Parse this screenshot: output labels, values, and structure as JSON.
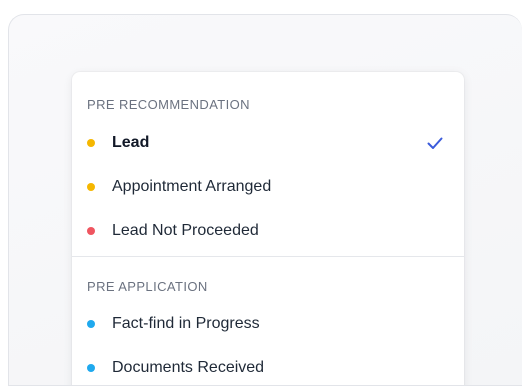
{
  "dropdown": {
    "sections": [
      {
        "header": "PRE RECOMMENDATION",
        "options": [
          {
            "label": "Lead",
            "dot_color": "#f5b700",
            "selected": true
          },
          {
            "label": "Appointment Arranged",
            "dot_color": "#f5b700",
            "selected": false
          },
          {
            "label": "Lead Not Proceeded",
            "dot_color": "#ef5560",
            "selected": false
          }
        ]
      },
      {
        "header": "PRE APPLICATION",
        "options": [
          {
            "label": "Fact-find in Progress",
            "dot_color": "#1fa9ee",
            "selected": false
          },
          {
            "label": "Documents Received",
            "dot_color": "#1fa9ee",
            "selected": false
          }
        ]
      }
    ],
    "selected_icon": "check-icon",
    "check_color": "#3b5bdb"
  }
}
